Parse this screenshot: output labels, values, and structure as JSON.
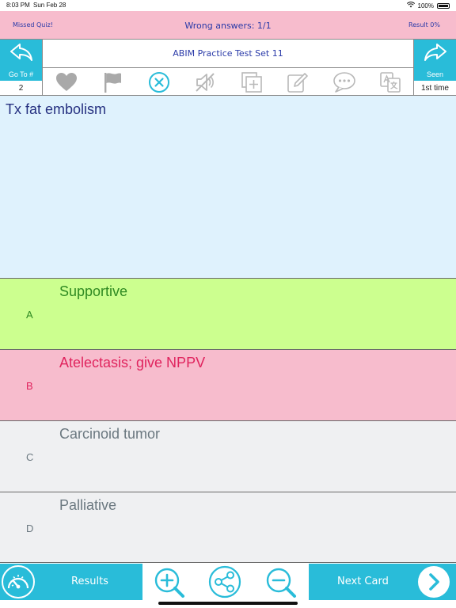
{
  "status_bar": {
    "time": "8:03 PM",
    "date": "Sun Feb 28",
    "battery": "100%"
  },
  "score_bar": {
    "missed_label": "Missed Quiz!",
    "wrong_answers": "Wrong answers: 1/1",
    "result": "Result 0%"
  },
  "title_bar": {
    "title": "ABIM Practice Test Set 11",
    "back_icon": "back-arrow-icon",
    "forward_icon": "forward-arrow-icon"
  },
  "toolbar": {
    "goto_label": "Go To #",
    "goto_value": "2",
    "seen_label": "Seen",
    "seen_value": "1st time",
    "icons": [
      "heart-icon",
      "flag-icon",
      "remove-circle-icon",
      "mute-icon",
      "add-card-icon",
      "edit-icon",
      "comment-icon",
      "translate-icon"
    ]
  },
  "question": {
    "text": "Tx fat embolism"
  },
  "answers": [
    {
      "letter": "A",
      "text": "Supportive",
      "state": "correct"
    },
    {
      "letter": "B",
      "text": "Atelectasis; give NPPV",
      "state": "wrong"
    },
    {
      "letter": "C",
      "text": "Carcinoid tumor",
      "state": "neutral"
    },
    {
      "letter": "D",
      "text": "Palliative",
      "state": "neutral"
    }
  ],
  "bottom_bar": {
    "results_label": "Results",
    "next_label": "Next Card",
    "icons": [
      "gauge-icon",
      "zoom-in-icon",
      "share-icon",
      "zoom-out-icon",
      "next-arrow-icon"
    ]
  },
  "colors": {
    "accent": "#29bcd9",
    "correct_bg": "#ccff8f",
    "wrong_bg": "#f7bccd",
    "question_bg": "#dff2fd",
    "neutral_bg": "#eff0f2"
  }
}
